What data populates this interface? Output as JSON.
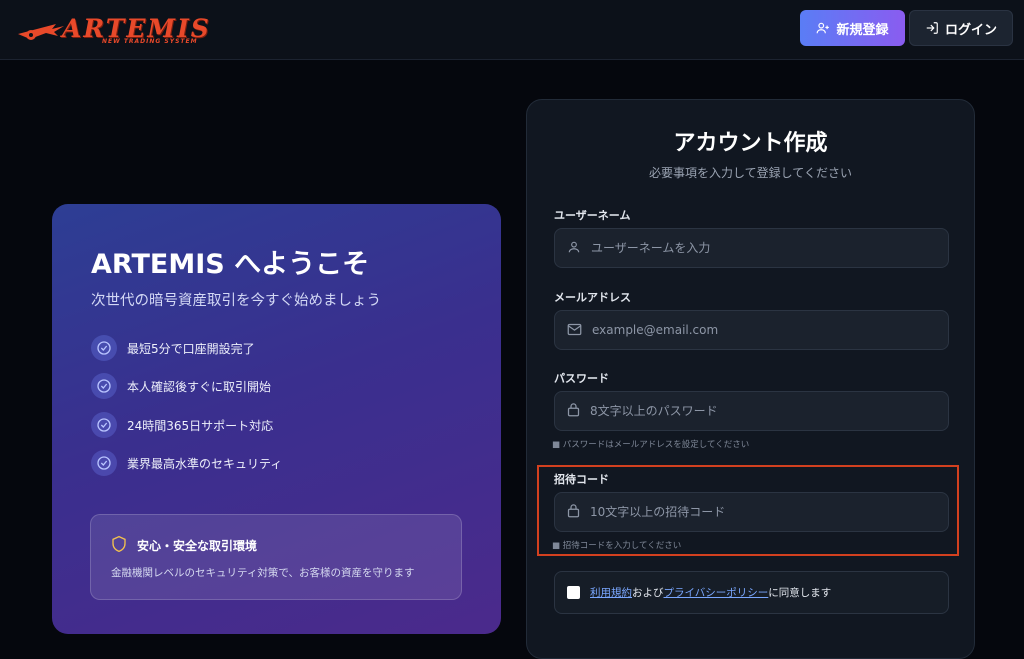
{
  "brand": {
    "name": "ARTEMIS",
    "tagline": "NEW TRADING SYSTEM",
    "color": "#e8492a"
  },
  "header": {
    "register_label": "新規登録",
    "login_label": "ログイン"
  },
  "welcome": {
    "title": "ARTEMIS へようこそ",
    "subtitle": "次世代の暗号資産取引を今すぐ始めましょう",
    "features": [
      "最短5分で口座開設完了",
      "本人確認後すぐに取引開始",
      "24時間365日サポート対応",
      "業界最高水準のセキュリティ"
    ],
    "secure_title": "安心・安全な取引環境",
    "secure_text": "金融機関レベルのセキュリティ対策で、お客様の資産を守ります"
  },
  "form": {
    "title": "アカウント作成",
    "subtitle": "必要事項を入力して登録してください",
    "username": {
      "label": "ユーザーネーム",
      "placeholder": "ユーザーネームを入力"
    },
    "email": {
      "label": "メールアドレス",
      "placeholder": "example@email.com"
    },
    "password": {
      "label": "パスワード",
      "placeholder": "8文字以上のパスワード",
      "hint": "■ パスワードはメールアドレスを設定してください"
    },
    "invite": {
      "label": "招待コード",
      "placeholder": "10文字以上の招待コード",
      "hint": "■ 招待コードを入力してください"
    },
    "agree": {
      "terms_link": "利用規約",
      "and": "および",
      "privacy_link": "プライバシーポリシー",
      "suffix": "に同意します"
    }
  },
  "colors": {
    "accent_gradient_start": "#5a7df5",
    "accent_gradient_end": "#8a5cf0",
    "highlight_border": "#d3401f"
  }
}
